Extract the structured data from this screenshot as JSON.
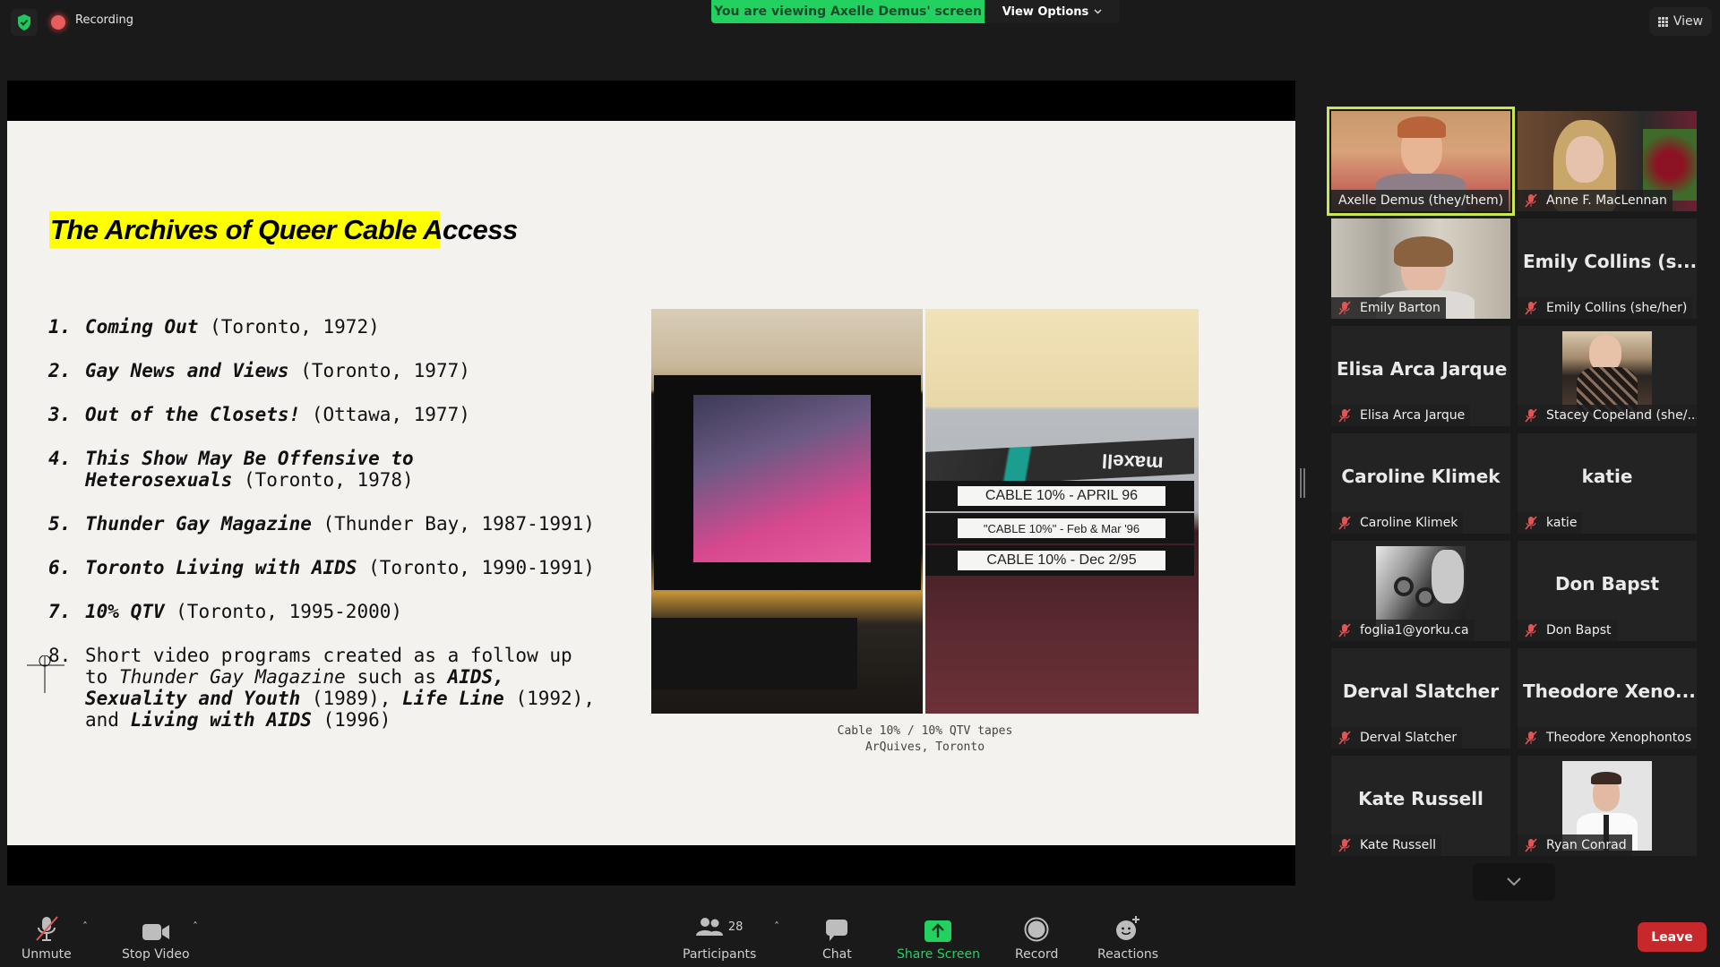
{
  "top_bar": {
    "recording_label": "Recording",
    "banner_text": "You are viewing Axelle Demus' screen",
    "view_options_label": "View Options",
    "view_label": "View"
  },
  "slide": {
    "title": "The Archives of Queer Cable Access",
    "items": [
      {
        "num": "1.",
        "title": "Coming Out",
        "rest": " (Toronto, 1972)"
      },
      {
        "num": "2.",
        "title": "Gay News and Views",
        "rest": " (Toronto, 1977)"
      },
      {
        "num": "3.",
        "title": "Out of the Closets!",
        "rest": " (Ottawa, 1977)"
      },
      {
        "num": "4.",
        "title": "This Show May Be Offensive to Heterosexuals",
        "rest": " (Toronto, 1978)"
      },
      {
        "num": "5.",
        "title": "Thunder Gay Magazine",
        "rest": " (Thunder Bay, 1987-1991)"
      },
      {
        "num": "6.",
        "title": "Toronto Living with AIDS",
        "rest": " (Toronto, 1990-1991)"
      },
      {
        "num": "7.",
        "title": "10% QTV",
        "rest": " (Toronto, 1995-2000)"
      }
    ],
    "item8": {
      "num": "8.",
      "part1": "Short video programs created as a follow up to ",
      "italic1": "Thunder Gay Magazine",
      "part2": " such as ",
      "bold1": "AIDS, Sexuality and Youth",
      "part3": " (1989), ",
      "bold2": "Life Line",
      "part4": " (1992), and ",
      "bold3": "Living with AIDS",
      "part5": " (1996)"
    },
    "photo": {
      "tape_labels": [
        "CABLE 10% - APRIL 96",
        "\"CABLE 10%\" - Feb & Mar '96",
        "CABLE 10% - Dec 2/95"
      ],
      "brand": "maxell"
    },
    "caption_line1": "Cable 10% / 10% QTV tapes",
    "caption_line2": "ArQuives, Toronto"
  },
  "gallery": {
    "participants": [
      {
        "display": "Axelle Demus (they/them)",
        "big": "",
        "muted": false,
        "active": true,
        "video": "axelle"
      },
      {
        "display": "Anne F. MacLennan",
        "big": "",
        "muted": true,
        "active": false,
        "video": "anne"
      },
      {
        "display": "Emily Barton",
        "big": "",
        "muted": true,
        "active": false,
        "video": "emily-barton"
      },
      {
        "display": "Emily Collins (she/her)",
        "big": "Emily Collins (s...",
        "muted": true,
        "active": false,
        "video": ""
      },
      {
        "display": "Elisa Arca Jarque",
        "big": "Elisa Arca Jarque",
        "muted": true,
        "active": false,
        "video": ""
      },
      {
        "display": "Stacey Copeland (she/...",
        "big": "",
        "muted": true,
        "active": false,
        "video": "stacey"
      },
      {
        "display": "Caroline Klimek",
        "big": "Caroline Klimek",
        "muted": true,
        "active": false,
        "video": ""
      },
      {
        "display": "katie",
        "big": "katie",
        "muted": true,
        "active": false,
        "video": ""
      },
      {
        "display": "foglia1@yorku.ca",
        "big": "",
        "muted": true,
        "active": false,
        "video": "foglia"
      },
      {
        "display": "Don Bapst",
        "big": "Don Bapst",
        "muted": true,
        "active": false,
        "video": ""
      },
      {
        "display": "Derval Slatcher",
        "big": "Derval Slatcher",
        "muted": true,
        "active": false,
        "video": ""
      },
      {
        "display": "Theodore Xenophontos",
        "big": "Theodore Xeno...",
        "muted": true,
        "active": false,
        "video": ""
      },
      {
        "display": "Kate Russell",
        "big": "Kate Russell",
        "muted": true,
        "active": false,
        "video": ""
      },
      {
        "display": "Ryan Conrad",
        "big": "",
        "muted": true,
        "active": false,
        "video": "ryan"
      }
    ]
  },
  "toolbar": {
    "unmute_label": "Unmute",
    "stop_video_label": "Stop Video",
    "participants_label": "Participants",
    "participants_count": "28",
    "chat_label": "Chat",
    "share_screen_label": "Share Screen",
    "record_label": "Record",
    "reactions_label": "Reactions",
    "leave_label": "Leave"
  },
  "colors": {
    "banner_green": "#22d160",
    "share_green": "#22d160",
    "active_speaker": "#c8e84c",
    "leave_red": "#c7282b",
    "muted_red": "#e05555",
    "title_highlight": "#ffff00"
  }
}
